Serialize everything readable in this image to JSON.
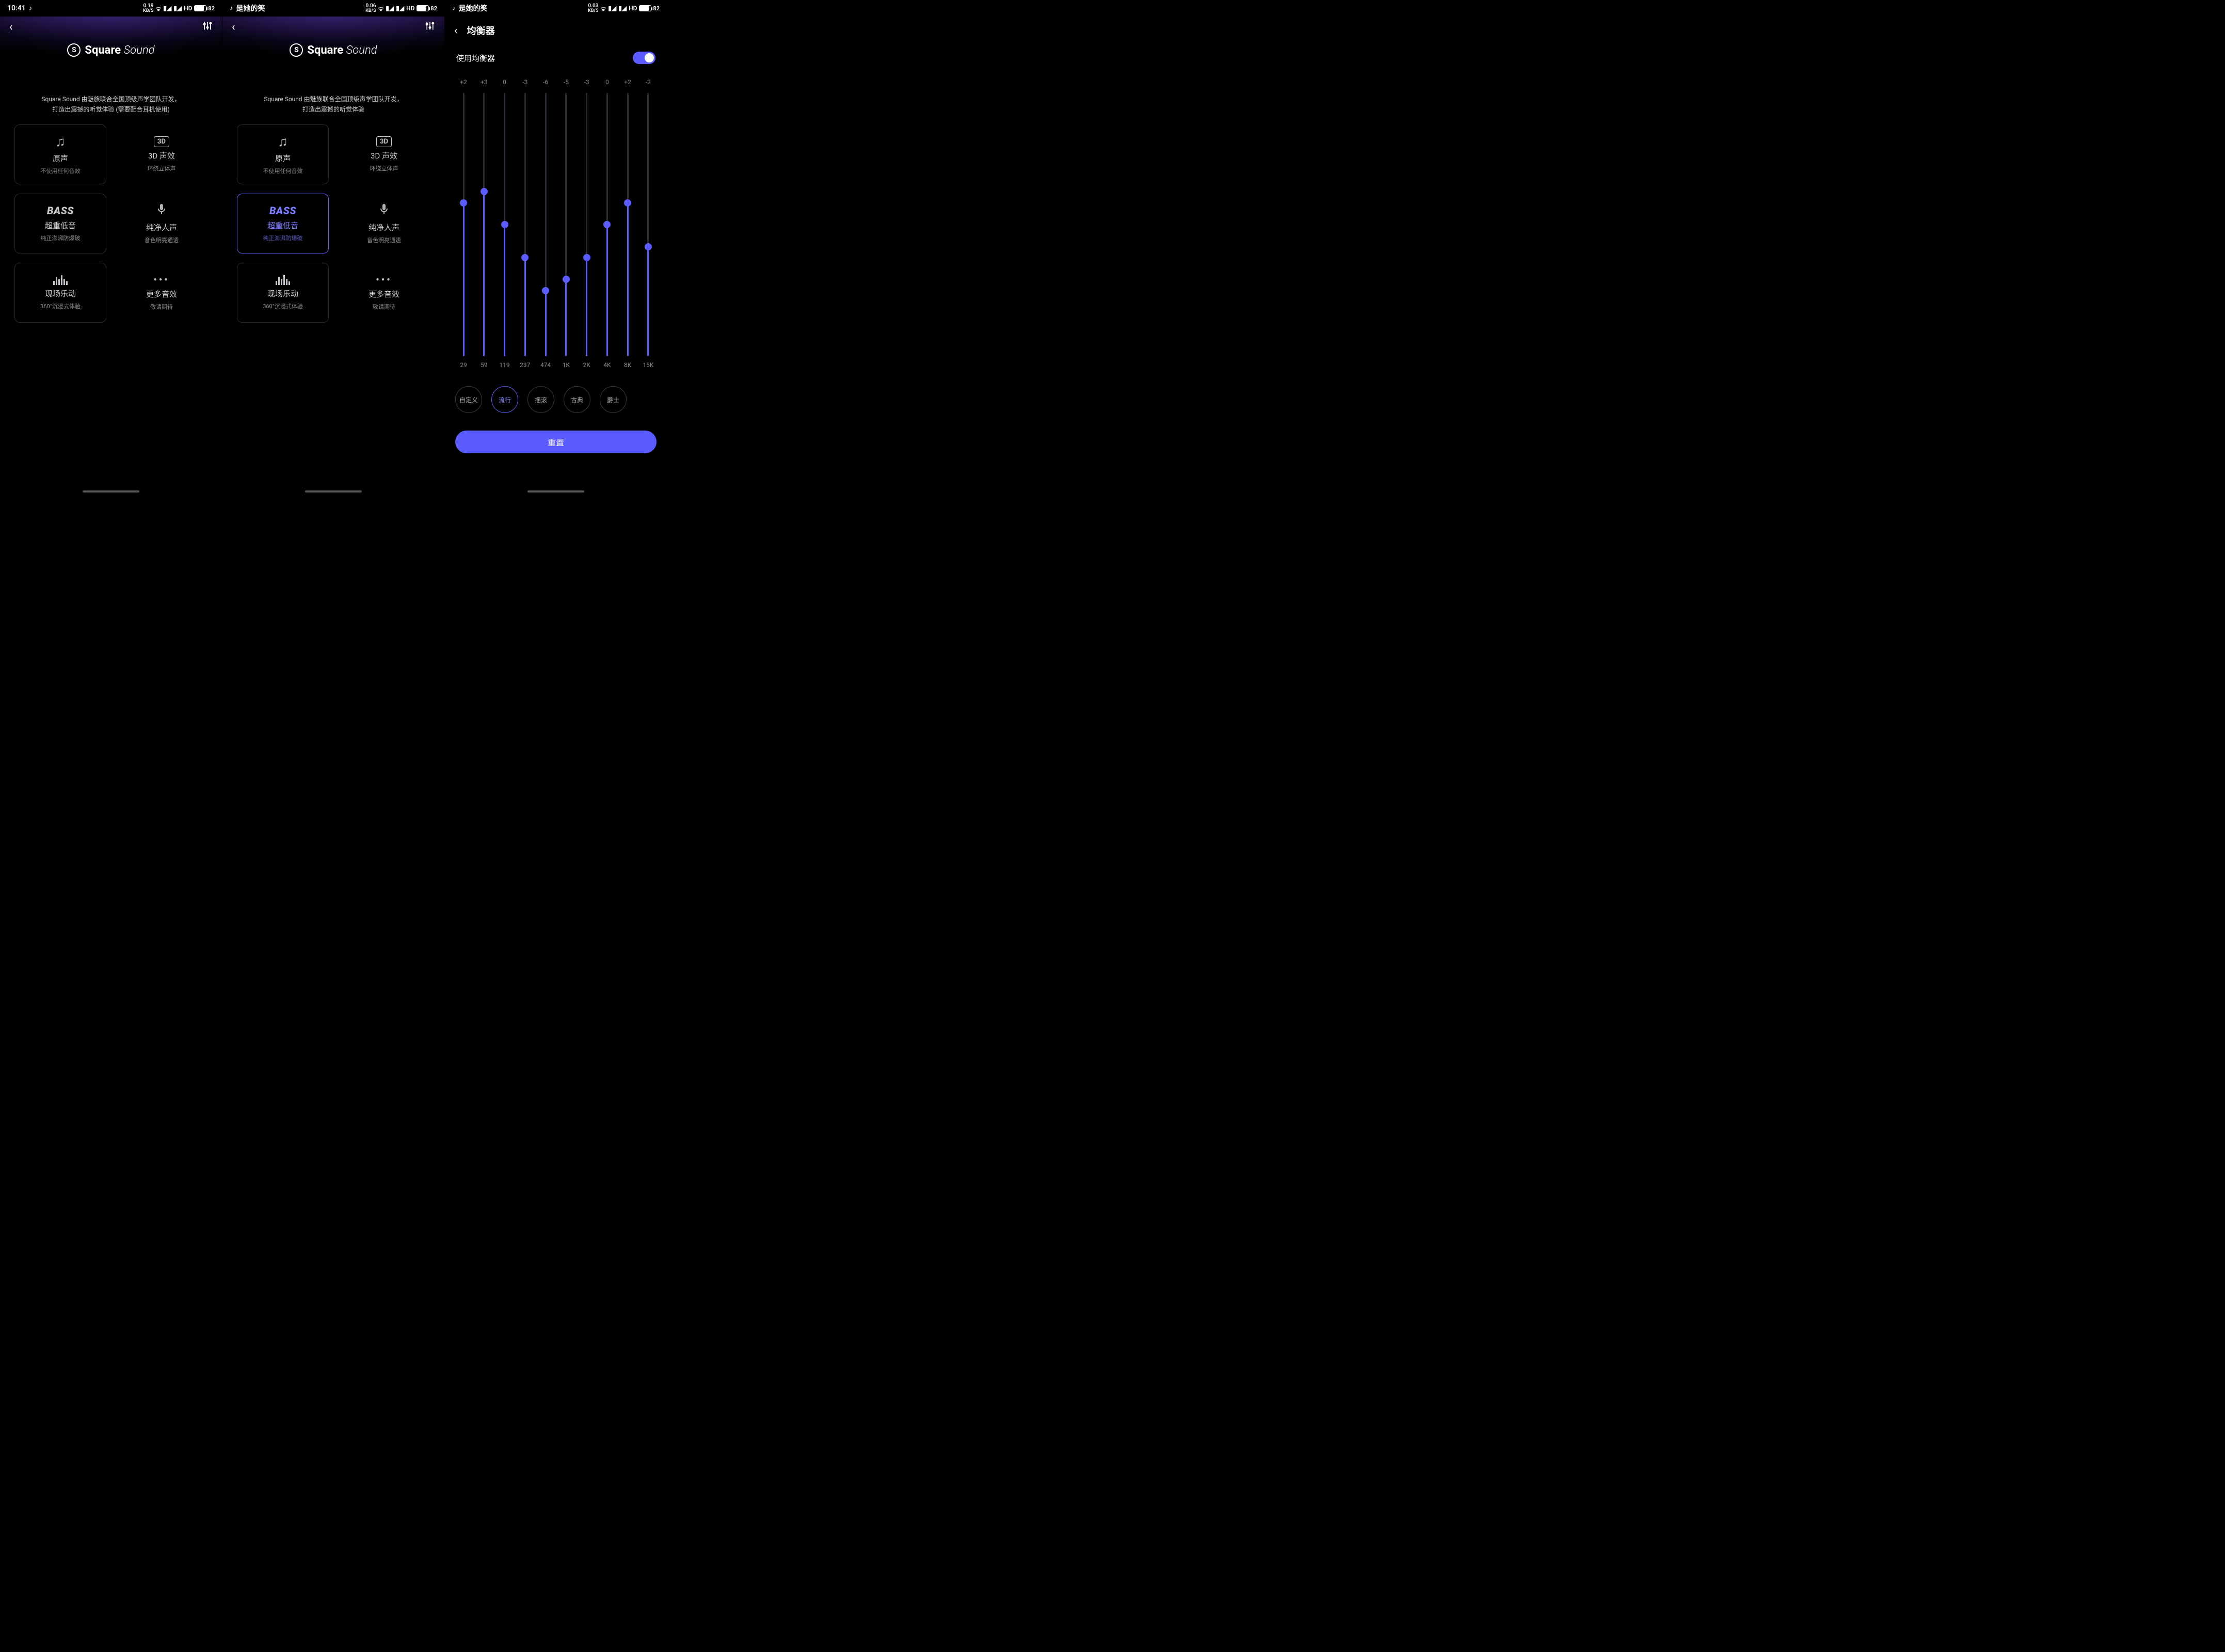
{
  "status": {
    "time": "10:41",
    "song_prefix": "是她的笑",
    "net1": "0.19",
    "net2": "0.06",
    "net3": "0.03",
    "net_unit": "KB/S",
    "sig1": "3G",
    "sig2": "4G+",
    "hd": "HD",
    "battery": "82"
  },
  "brand": {
    "square": "Square",
    "sound": "Sound"
  },
  "desc": {
    "line1": "Square Sound 由魅族联合全国顶级声学团队开发，",
    "line2a": "打造出震撼的听觉体验 (需要配合耳机使用)",
    "line2b": "打造出震撼的听觉体验"
  },
  "effects": {
    "original": {
      "title": "原声",
      "sub": "不使用任何音效"
    },
    "threeD": {
      "title": "3D 声效",
      "sub": "环绕立体声",
      "icon": "3D"
    },
    "bass": {
      "title": "超重低音",
      "sub": "纯正澎湃防爆破",
      "icon": "BASS"
    },
    "vocal": {
      "title": "纯净人声",
      "sub": "音色明亮通透"
    },
    "live": {
      "title": "现场乐动",
      "sub": "360°沉浸式体验"
    },
    "more": {
      "title": "更多音效",
      "sub": "敬请期待"
    }
  },
  "eq": {
    "title": "均衡器",
    "use_label": "使用均衡器",
    "reset": "重置",
    "bands": [
      {
        "freq": "29",
        "val": 2
      },
      {
        "freq": "59",
        "val": 3
      },
      {
        "freq": "119",
        "val": 0
      },
      {
        "freq": "237",
        "val": -3
      },
      {
        "freq": "474",
        "val": -6
      },
      {
        "freq": "1K",
        "val": -5
      },
      {
        "freq": "2K",
        "val": -3
      },
      {
        "freq": "4K",
        "val": 0
      },
      {
        "freq": "8K",
        "val": 2
      },
      {
        "freq": "15K",
        "val": -2
      }
    ],
    "presets": [
      "自定义",
      "流行",
      "摇滚",
      "古典",
      "爵士"
    ],
    "selected_preset": 1,
    "range": 12
  }
}
